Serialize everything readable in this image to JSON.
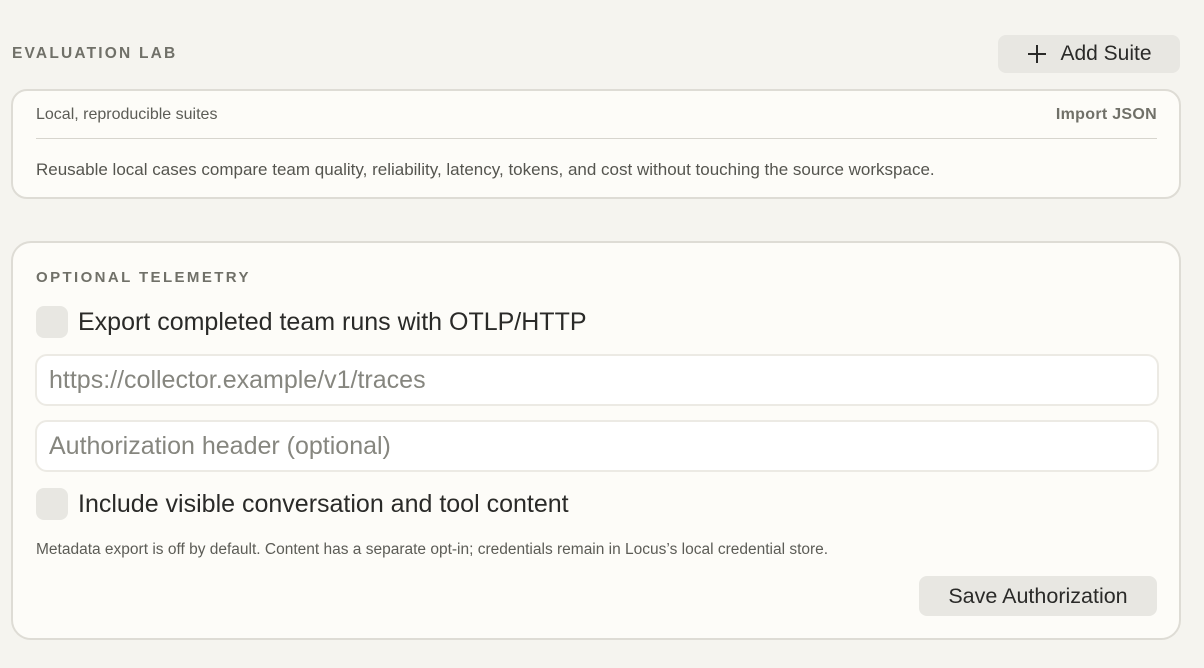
{
  "eval_lab": {
    "heading": "EVALUATION LAB",
    "add_suite_label": "Add Suite",
    "add_suite_icon": "plus-icon",
    "subtitle": "Local, reproducible suites",
    "import_label": "Import JSON",
    "description": "Reusable local cases compare team quality, reliability, latency, tokens, and cost without touching the source workspace."
  },
  "telemetry": {
    "heading": "OPTIONAL TELEMETRY",
    "export_checkbox": {
      "label": "Export completed team runs with OTLP/HTTP",
      "checked": false
    },
    "endpoint_input": {
      "value": "",
      "placeholder": "https://collector.example/v1/traces"
    },
    "auth_input": {
      "value": "",
      "placeholder": "Authorization header (optional)"
    },
    "content_checkbox": {
      "label": "Include visible conversation and tool content",
      "checked": false
    },
    "note": "Metadata export is off by default. Content has a separate opt-in; credentials remain in Locus’s local credential store.",
    "save_label": "Save Authorization"
  }
}
